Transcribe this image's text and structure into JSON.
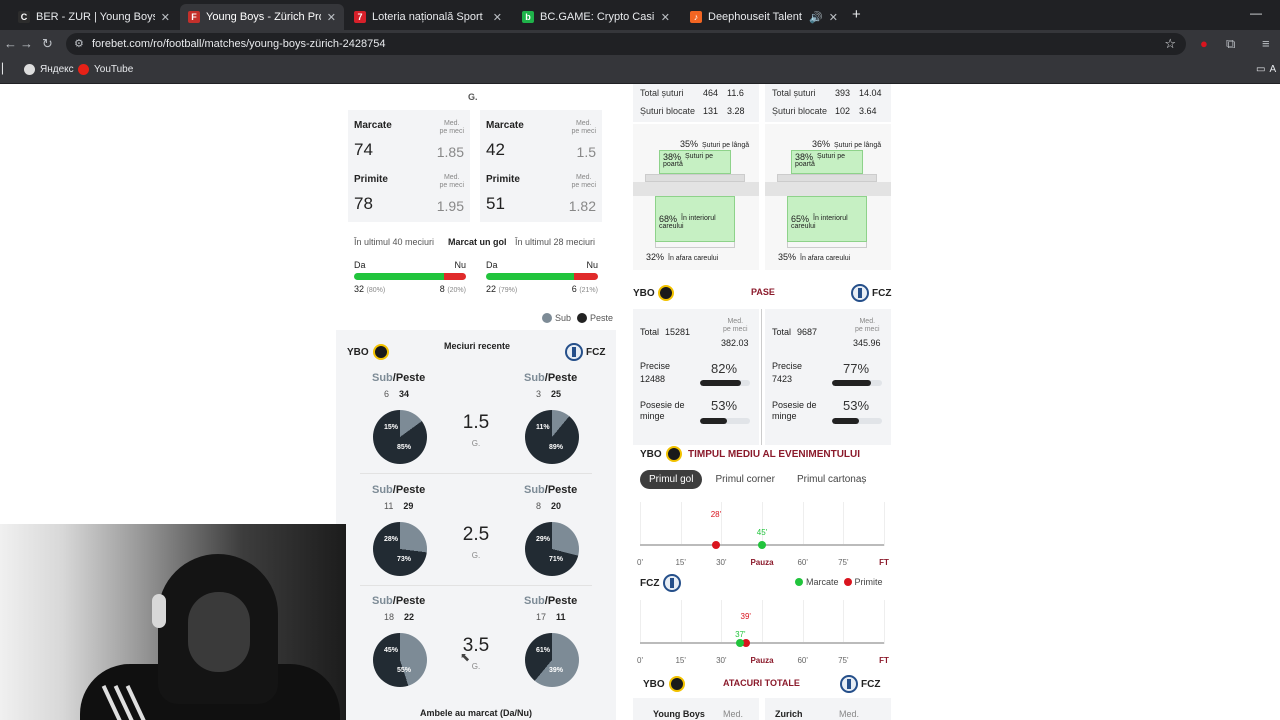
{
  "browser": {
    "tabs": [
      {
        "title": "BER - ZUR | Young Boys v Zurich",
        "favicon": "C",
        "color": "#202124",
        "active": false
      },
      {
        "title": "Young Boys - Zürich Pronosticuri",
        "favicon": "F",
        "color": "#c4302b",
        "active": true
      },
      {
        "title": "Loteria națională Sport",
        "favicon": "7",
        "color": "#d6202a",
        "active": false
      },
      {
        "title": "BC.GAME: Crypto Casino Games",
        "favicon": "b",
        "color": "#1fb34a",
        "active": false
      },
      {
        "title": "Deephouseit Talent Mix - dj",
        "favicon": "♪",
        "color": "#f26522",
        "active": false
      }
    ],
    "url": "forebet.com/ro/football/matches/young-boys-zürich-2428754",
    "bookmarks": [
      "Яндекс",
      "YouTube"
    ],
    "bookmarks_right": "A"
  },
  "goals_top": {
    "g": "G."
  },
  "goal_stats": {
    "ybo": {
      "scored_label": "Marcate",
      "scored": "74",
      "scored_avg": "1.85",
      "conceded_label": "Primite",
      "conceded": "78",
      "conceded_avg": "1.95"
    },
    "fcz": {
      "scored_label": "Marcate",
      "scored": "42",
      "scored_avg": "1.5",
      "conceded_label": "Primite",
      "conceded": "51",
      "conceded_avg": "1.82"
    },
    "med_label_1": "Med.",
    "med_label_2": "pe meci"
  },
  "marcat_gol": {
    "tab_left": "În ultimul 40 meciuri",
    "tab_mid": "Marcat un gol",
    "tab_right": "În ultimul 28 meciuri",
    "yes": "Da",
    "no": "Nu",
    "ybo": {
      "yes": "32",
      "yes_pct": "(80%)",
      "no": "8",
      "no_pct": "(20%)",
      "yes_share": 80
    },
    "fcz": {
      "yes": "22",
      "yes_pct": "(79%)",
      "no": "6",
      "no_pct": "(21%)",
      "yes_share": 79
    }
  },
  "legend": {
    "sub": "Sub",
    "peste": "Peste",
    "sub_color": "#7d8b96",
    "peste_color": "#222222"
  },
  "recent": {
    "home": "YBO",
    "away": "FCZ",
    "title": "Meciuri recente",
    "sub": "Sub",
    "peste": "/Peste",
    "rows": [
      {
        "line": "1.5",
        "g": "G.",
        "home_sub": "6",
        "home_over": "34",
        "home_sub_pct": "15%",
        "home_over_pct": "85%",
        "home_over_share": 85,
        "away_sub": "3",
        "away_over": "25",
        "away_sub_pct": "11%",
        "away_over_pct": "89%",
        "away_over_share": 89
      },
      {
        "line": "2.5",
        "g": "G.",
        "home_sub": "11",
        "home_over": "29",
        "home_sub_pct": "28%",
        "home_over_pct": "73%",
        "home_over_share": 73,
        "away_sub": "8",
        "away_over": "20",
        "away_sub_pct": "29%",
        "away_over_pct": "71%",
        "away_over_share": 71
      },
      {
        "line": "3.5",
        "g": "G.",
        "home_sub": "18",
        "home_over": "22",
        "home_sub_pct": "45%",
        "home_over_pct": "55%",
        "home_over_share": 55,
        "away_sub": "17",
        "away_over": "11",
        "away_sub_pct": "61%",
        "away_over_pct": "39%",
        "away_over_share": 39
      }
    ],
    "both_scored": "Ambele au marcat (Da/Nu)"
  },
  "shots": {
    "ybo": {
      "total_label": "Total șuturi",
      "total": "464",
      "total_avg": "11.6",
      "blocked_label": "Șuturi blocate",
      "blocked": "131",
      "blocked_avg": "3.28",
      "wide": "35%",
      "on_target": "38%",
      "inside": "68%",
      "outside": "32%"
    },
    "fcz": {
      "total_label": "Total șuturi",
      "total": "393",
      "total_avg": "14.04",
      "blocked_label": "Șuturi blocate",
      "blocked": "102",
      "blocked_avg": "3.64",
      "wide": "36%",
      "on_target": "38%",
      "inside": "65%",
      "outside": "35%"
    },
    "wide_label": "Șuturi pe lângă",
    "on_target_label_1": "Șuturi pe",
    "on_target_label_2": "poartă",
    "inside_label_1": "În interiorul",
    "inside_label_2": "careului",
    "outside_label": "În afara careului"
  },
  "passes": {
    "home": "YBO",
    "away": "FCZ",
    "title": "PASE",
    "total_label": "Total",
    "med_1": "Med.",
    "med_2": "pe meci",
    "precise_label": "Precise",
    "poss_label_1": "Posesie de",
    "poss_label_2": "minge",
    "ybo": {
      "total": "15281",
      "avg": "382.03",
      "precise": "12488",
      "precise_pct": "82%",
      "precise_share": 82,
      "poss_pct": "53%",
      "poss_share": 53
    },
    "fcz": {
      "total": "9687",
      "avg": "345.96",
      "precise": "7423",
      "precise_pct": "77%",
      "precise_share": 77,
      "poss_pct": "53%",
      "poss_share": 53
    }
  },
  "events": {
    "home": "YBO",
    "away": "FCZ",
    "title": "TIMPUL MEDIU AL EVENIMENTULUI",
    "tabs": [
      "Primul gol",
      "Primul corner",
      "Primul cartonaș"
    ],
    "ticks": [
      "0'",
      "15'",
      "30'",
      "Pauza",
      "60'",
      "75'",
      "FT"
    ],
    "ybo": {
      "conceded_min": 28,
      "conceded_label": "28'",
      "scored_min": 45,
      "scored_label": "45'"
    },
    "fcz": {
      "conceded_min": 39,
      "conceded_label": "39'",
      "scored_min": 37,
      "scored_label": "37'"
    },
    "legend_scored": "Marcate",
    "legend_conceded": "Primite",
    "scored_color": "#21c43c",
    "conceded_color": "#d9141e"
  },
  "attacks": {
    "home": "YBO",
    "away": "FCZ",
    "title": "ATACURI TOTALE",
    "home_name": "Young Boys",
    "away_name": "Zurich",
    "med": "Med."
  }
}
